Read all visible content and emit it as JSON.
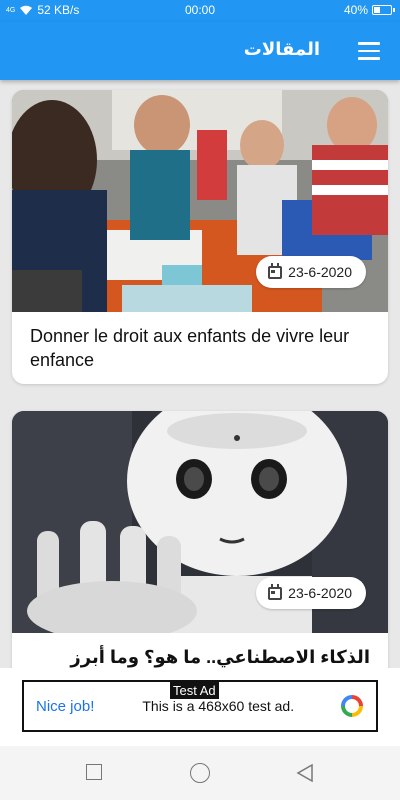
{
  "status": {
    "signal": "4G",
    "speed": "52 KB/s",
    "time": "00:00",
    "battery": "40%",
    "battery_level": 0.4
  },
  "appbar": {
    "title": "المقالات"
  },
  "articles": [
    {
      "title": "Donner le droit aux enfants de vivre leur enfance",
      "date": "23-6-2020"
    },
    {
      "title": "الذكاء الاصطناعي.. ما هو؟ وما أبرز مظاهره؟",
      "date": "23-6-2020"
    }
  ],
  "ad": {
    "label": "Test Ad",
    "cta": "Nice job!",
    "message": "This is a 468x60 test ad."
  },
  "colors": {
    "primary": "#2196f3",
    "ad_link": "#1a73e8"
  }
}
